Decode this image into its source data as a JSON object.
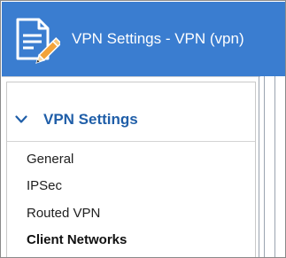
{
  "window": {
    "title": "VPN Settings - VPN (vpn)"
  },
  "icons": {
    "title_icon": "document-edit-icon",
    "collapse_icon": "chevron-down-icon"
  },
  "sidebar": {
    "section_title": "VPN Settings",
    "items": [
      {
        "label": "General",
        "active": false
      },
      {
        "label": "IPSec",
        "active": false
      },
      {
        "label": "Routed VPN",
        "active": false
      },
      {
        "label": "Client Networks",
        "active": true
      }
    ]
  },
  "colors": {
    "titlebar": "#3a7dd0",
    "section_title": "#1f5ea8"
  }
}
